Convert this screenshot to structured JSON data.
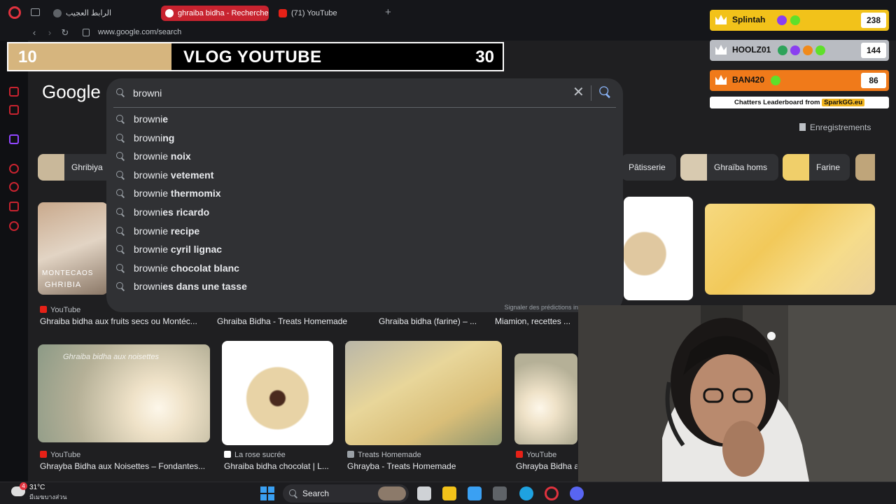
{
  "browser": {
    "tabs": [
      {
        "label": "الرابط العجيب",
        "active": false
      },
      {
        "label": "ghraiba bidha - Recherche",
        "active": true
      },
      {
        "label": "(71) YouTube",
        "active": false
      }
    ],
    "new_tab_label": "+",
    "url": "www.google.com/search"
  },
  "overlay": {
    "left_number": "10",
    "title": "VLOG YOUTUBE",
    "right_number": "30",
    "progress_fraction": 0.33
  },
  "google": {
    "logo": "Google",
    "search": {
      "value": "browni",
      "placeholder": ""
    },
    "suggestions": [
      {
        "prefix": "browni",
        "suffix": "e"
      },
      {
        "prefix": "browni",
        "suffix": "ng"
      },
      {
        "prefix": "brownie",
        "suffix": " noix"
      },
      {
        "prefix": "brownie",
        "suffix": " vetement"
      },
      {
        "prefix": "brownie",
        "suffix": " thermomix"
      },
      {
        "prefix": "browni",
        "suffix": "es ricardo"
      },
      {
        "prefix": "brownie",
        "suffix": " recipe"
      },
      {
        "prefix": "brownie",
        "suffix": " cyril lignac"
      },
      {
        "prefix": "brownie",
        "suffix": " chocolat blanc"
      },
      {
        "prefix": "browni",
        "suffix": "es dans une tasse"
      }
    ],
    "report_label": "Signaler des prédictions in",
    "saved_label": "Enregistrements",
    "chips": [
      {
        "label": "Ghribiya"
      },
      {
        "label": "Pâtisserie"
      },
      {
        "label": "Ghraïba homs"
      },
      {
        "label": "Farine"
      }
    ],
    "image_captions_row1": [
      {
        "source": "YouTube",
        "title": "Ghraiba bidha aux fruits secs ou Montéc..."
      },
      {
        "source": "",
        "title": "Ghraiba Bidha - Treats Homemade"
      },
      {
        "source": "",
        "title": "Ghraiba bidha (farine) – ..."
      },
      {
        "source": "",
        "title": "Miamion, recettes ..."
      }
    ],
    "image_captions_row2": [
      {
        "source": "YouTube",
        "title": "Ghrayba Bidha aux Noisettes – Fondantes..."
      },
      {
        "source": "La rose sucrée",
        "title": "Ghraiba bidha chocolat | L..."
      },
      {
        "source": "Treats Homemade",
        "title": "Ghrayba - Treats Homemade"
      },
      {
        "source": "YouTube",
        "title": "Ghrayba Bidha a"
      }
    ],
    "image_overlay_text": [
      "MONTECAOS",
      "GHRIBIA"
    ],
    "image_watermark": "Ghraiba bidha aux noisettes"
  },
  "leaderboard": {
    "rows": [
      {
        "name": "Splintah",
        "score": "238",
        "color": "#f2c21a"
      },
      {
        "name": "HOOLZ01",
        "score": "144",
        "color": "#b9bcc2"
      },
      {
        "name": "BAN420",
        "score": "86",
        "color": "#f07a1a"
      }
    ],
    "footer_text": "Chatters Leaderboard from",
    "footer_brand": "SparkGG.eu"
  },
  "taskbar": {
    "weather_temp": "31°C",
    "weather_desc": "มีเมฆบางส่วน",
    "weather_badge": "4",
    "search_label": "Search"
  }
}
